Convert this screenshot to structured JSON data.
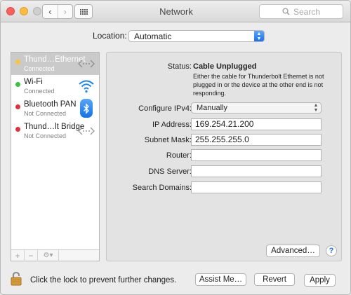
{
  "window": {
    "title": "Network"
  },
  "toolbar": {
    "back_glyph": "‹",
    "forward_glyph": "›",
    "search_placeholder": "Search"
  },
  "location": {
    "label": "Location:",
    "value": "Automatic"
  },
  "services": [
    {
      "name": "Thund…Ethernet",
      "status": "Connected",
      "dot_color": "#f5c642",
      "icon": "ethernet-arrows-icon",
      "selected": true
    },
    {
      "name": "Wi-Fi",
      "status": "Connected",
      "dot_color": "#3cc23f",
      "icon": "wifi-icon",
      "selected": false
    },
    {
      "name": "Bluetooth PAN",
      "status": "Not Connected",
      "dot_color": "#e0323a",
      "icon": "bluetooth-icon",
      "selected": false
    },
    {
      "name": "Thund…lt Bridge",
      "status": "Not Connected",
      "dot_color": "#e0323a",
      "icon": "ethernet-arrows-icon",
      "selected": false
    }
  ],
  "sidebar_footer": {
    "add": "+",
    "remove": "−",
    "gear": "⚙▾"
  },
  "detail": {
    "status_label": "Status:",
    "status_value": "Cable Unplugged",
    "status_description": "Either the cable for Thunderbolt Ethernet is not plugged in or the device at the other end is not responding.",
    "configure_label": "Configure IPv4:",
    "configure_value": "Manually",
    "ip_label": "IP Address:",
    "ip_value": "169.254.21.200",
    "subnet_label": "Subnet Mask:",
    "subnet_value": "255.255.255.0",
    "router_label": "Router:",
    "router_value": "",
    "dns_label": "DNS Server:",
    "dns_value": "",
    "search_domains_label": "Search Domains:",
    "search_domains_value": "",
    "advanced_label": "Advanced…",
    "help_label": "?"
  },
  "footer": {
    "lock_text": "Click the lock to prevent further changes.",
    "assist_label": "Assist Me…",
    "revert_label": "Revert",
    "apply_label": "Apply"
  },
  "colors": {
    "accent": "#1c6fe9",
    "wifi": "#1a85f1"
  }
}
